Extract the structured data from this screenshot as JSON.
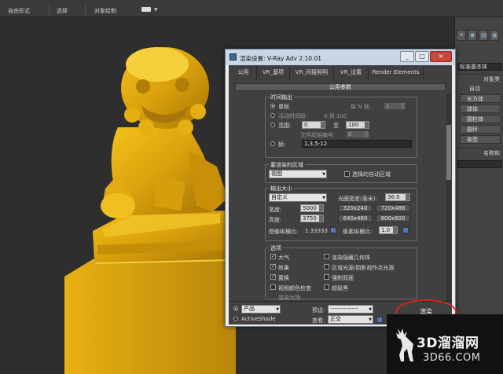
{
  "toolbar": {
    "item1": "自由形式",
    "item2": "选择",
    "item3": "对象绘制"
  },
  "command_panel": {
    "object_type_field": "标准基本体",
    "section_object_type": "对象类",
    "auto_grid": "自动",
    "buttons": [
      "长方体",
      "球体",
      "圆柱体",
      "圆环",
      "茶壶"
    ],
    "section_name_color": "名称和"
  },
  "dialog": {
    "title": "渲染设置: V-Ray Adv 2.10.01",
    "win_buttons": {
      "minimize": "_",
      "maximize": "□",
      "close": "×"
    },
    "tabs": [
      "公用",
      "VR_基项",
      "VR_间接照明",
      "VR_设置",
      "Render Elements"
    ],
    "rollout_title": "公用参数",
    "time_output": {
      "group_label": "时间输出",
      "single": "单帧",
      "every_n": "每 N 帧:",
      "every_n_value": "1",
      "active_segment": "活动时间段:",
      "active_range": "0 到 100",
      "range": "范围:",
      "range_from": "0",
      "range_to_label": "至",
      "range_to": "100",
      "file_start": "文件起始编号:",
      "file_start_value": "0",
      "frames": "帧:",
      "frames_value": "1,3,5-12"
    },
    "area": {
      "group_label": "要渲染的区域",
      "mode": "视图",
      "auto_region": "选择的自动区域"
    },
    "output_size": {
      "group_label": "输出大小",
      "mode": "自定义",
      "aperture_label": "光圈宽度(毫米):",
      "aperture_value": "36.0",
      "width_label": "宽度:",
      "width_value": "5000",
      "height_label": "高度:",
      "height_value": "3750",
      "presets": [
        "320x240",
        "720x486",
        "640x480",
        "800x600"
      ],
      "image_aspect_label": "图像纵横比:",
      "image_aspect_value": "1.33333",
      "pixel_aspect_label": "像素纵横比:",
      "pixel_aspect_value": "1.0"
    },
    "options": {
      "group_label": "选项",
      "atmosphere": "大气",
      "effects": "效果",
      "displacement": "置换",
      "video_color": "视频颜色检查",
      "render_to_fields": "渲染为场",
      "render_hidden": "渲染隐藏几何体",
      "area_lights": "区域光源/阴影视作点光源",
      "force_two_sided": "强制双面",
      "super_black": "超级黑"
    },
    "bottom": {
      "product": "产品",
      "activeshade": "ActiveShade",
      "preset_label": "预设:",
      "preset_value": "--------------",
      "view_label": "查看:",
      "view_value": "正交",
      "render": "渲染"
    }
  },
  "watermark": {
    "line1": "3D溜溜网",
    "line2": "3D66.COM"
  }
}
